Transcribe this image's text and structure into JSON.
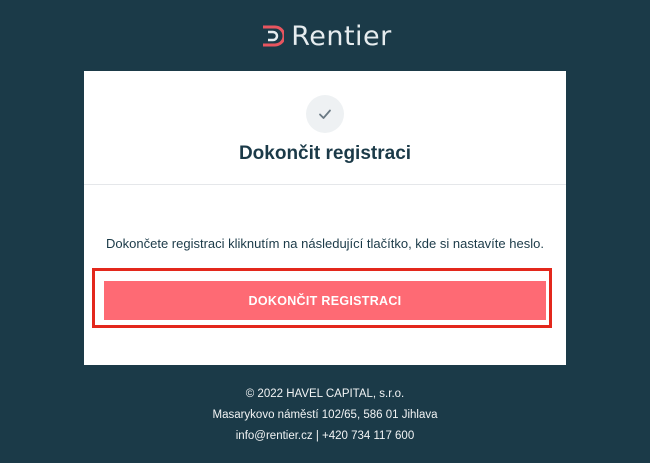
{
  "brand": {
    "name": "Rentier",
    "accent_color": "#fe6a74",
    "logo_icon": "rentier-logo-mark"
  },
  "card": {
    "icon": "checkmark-icon",
    "title": "Dokončit registraci",
    "message": "Dokončete registraci kliknutím na následující tlačítko, kde si nastavíte heslo.",
    "button_label": "DOKONČIT REGISTRACI",
    "highlight_color": "#e3281c"
  },
  "footer": {
    "copyright": "© 2022 HAVEL CAPITAL, s.r.o.",
    "address": "Masarykovo náměstí 102/65, 586 01 Jihlava",
    "email": "info@rentier.cz",
    "separator": "|",
    "phone": "+420 734 117 600"
  },
  "colors": {
    "background": "#1b3a48",
    "card": "#ffffff"
  }
}
